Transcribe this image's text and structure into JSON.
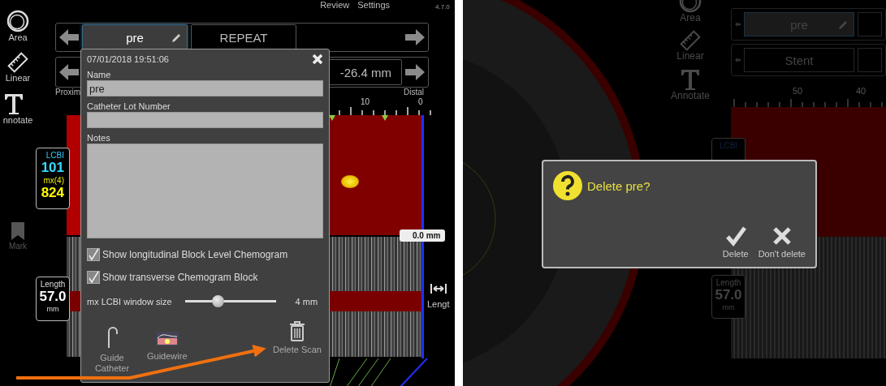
{
  "left_screen": {
    "top_menu": [
      {
        "label": "Review"
      },
      {
        "label": "Settings"
      }
    ],
    "version": "4.7.0",
    "tools": [
      {
        "kind": "area",
        "label": "Area"
      },
      {
        "kind": "linear",
        "label": "Linear"
      },
      {
        "kind": "annotate",
        "label": "nnotate"
      }
    ],
    "lcbi_box": {
      "label": "LCBI",
      "value": "101",
      "max_label": "mx(4)",
      "max_value": "824"
    },
    "mark": {
      "label": "Mark",
      "disabled": true
    },
    "length_box": {
      "label": "Length",
      "value": "57.0",
      "unit": "mm"
    },
    "scan_tabs": [
      {
        "label": "pre",
        "selected": true
      },
      {
        "label": "REPEAT",
        "selected": false
      }
    ],
    "segment_field": "-26.4 mm",
    "proximal_label": "Proxim",
    "distal_label": "Distal",
    "scale_labels": [
      "10",
      "0"
    ],
    "position_label": "0.0 mm",
    "length_tool": {
      "label": "Lengt"
    },
    "popup": {
      "timestamp": "07/01/2018 19:51:06",
      "fields": [
        {
          "kind": "input",
          "label": "Name",
          "value": "pre"
        },
        {
          "kind": "input",
          "label": "Catheter Lot Number"
        },
        {
          "kind": "textarea",
          "label": "Notes"
        }
      ],
      "options": [
        {
          "label": "Show longitudinal Block Level Chemogram",
          "checked": true
        },
        {
          "label": "Show transverse Chemogram Block",
          "checked": true
        }
      ],
      "slider": {
        "label": "mx LCBI window size",
        "level": 0.36,
        "reading": "4 mm"
      },
      "actions": [
        {
          "kind": "guide-catheter",
          "label": "Guide Catheter"
        },
        {
          "kind": "guidewire",
          "label": "Guidewire"
        },
        {
          "kind": "delete",
          "label": "Delete Scan"
        }
      ]
    }
  },
  "right_screen": {
    "tools": [
      {
        "kind": "area",
        "label": "Area"
      },
      {
        "kind": "linear",
        "label": "Linear"
      },
      {
        "kind": "annotate",
        "label": "Annotate"
      }
    ],
    "scan_tab": {
      "label": "pre"
    },
    "segment_tab": {
      "label": "Stent"
    },
    "scale_labels": [
      "50",
      "40"
    ],
    "lcbi_label": "LCBI",
    "length_box": {
      "label": "Length",
      "value": "57.0",
      "unit": "mm"
    },
    "dialog": {
      "message": "Delete pre?",
      "buttons": [
        {
          "kind": "confirm",
          "label": "Delete"
        },
        {
          "kind": "cancel",
          "label": "Don't delete"
        }
      ]
    }
  }
}
